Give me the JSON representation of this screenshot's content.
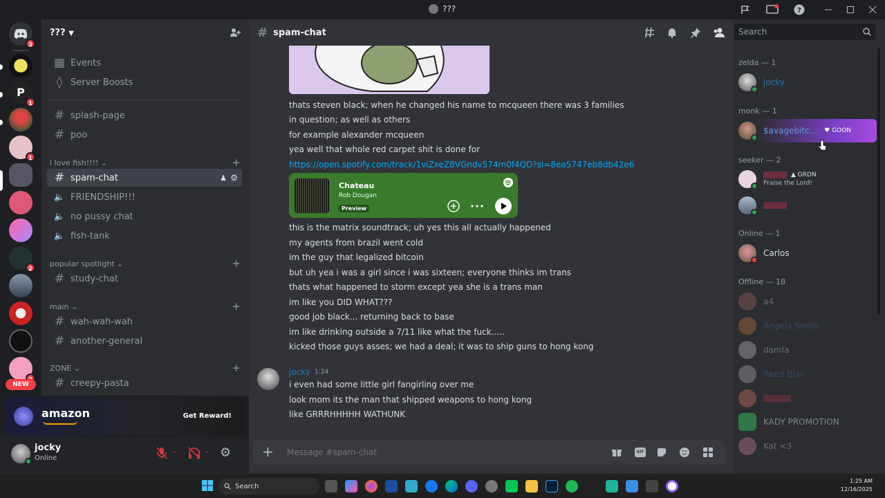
{
  "window": {
    "title": "???"
  },
  "server": {
    "name": "???"
  },
  "guild_badges": {
    "home": "3",
    "g3": "1",
    "g5": "1",
    "g9": "2",
    "g13": "2",
    "new": "NEW"
  },
  "sidebar": {
    "events": "Events",
    "boosts": "Server Boosts",
    "channels": [
      {
        "name": "splash-page",
        "type": "text"
      },
      {
        "name": "poo",
        "type": "text"
      }
    ],
    "cat1": "i love fish!!!!",
    "cat1_channels": [
      {
        "name": "spam-chat",
        "type": "text",
        "active": true
      },
      {
        "name": "FRIENDSHIP!!!",
        "type": "voice"
      },
      {
        "name": "no pussy chat",
        "type": "voice"
      },
      {
        "name": "fish-tank",
        "type": "voice"
      }
    ],
    "cat2": "popular spotlight",
    "cat2_channels": [
      {
        "name": "study-chat"
      }
    ],
    "cat3": "main",
    "cat3_channels": [
      {
        "name": "wah-wah-wah"
      },
      {
        "name": "another-general"
      }
    ],
    "cat4": "ZONE",
    "cat4_channels": [
      {
        "name": "creepy-pasta"
      }
    ]
  },
  "promo": {
    "brand": "amazon",
    "cta": "Get Reward!"
  },
  "user": {
    "name": "jocky",
    "status": "Online"
  },
  "channel": {
    "name": "spam-chat",
    "placeholder": "Message #spam-chat"
  },
  "messages": {
    "block1": [
      "thats steven black; when he changed his name to mcqueen there was 3 families",
      "in question; as well as others",
      "for example alexander mcqueen",
      "yea well that whole red carpet shit is done for"
    ],
    "link": "https://open.spotify.com/track/1viZxeZ8VGndv574m0f4QD?si=8ea5747eb8db42e6",
    "spotify": {
      "title": "Chateau",
      "artist": "Rob Dougan",
      "badge": "Preview"
    },
    "block2": [
      "this is the matrix soundtrack; uh yes this all actually happened",
      "my agents from brazil went cold",
      "im the guy that legalized bitcoin",
      "but uh yea i was a girl since i was sixteen; everyone thinks im trans",
      "thats what happened to storm except yea she is a trans man",
      "im like you DID WHAT???",
      "good job black... returning back to base",
      "im like drinking outside a 7/11 like what the fuck.....",
      "kicked those guys asses; we had a deal; it was to ship guns to hong kong"
    ],
    "author2": "jocky",
    "time2": "1:24",
    "block3": [
      "i even had some little girl fangirling over me",
      "look mom its the man that shipped weapons to hong kong",
      "like GRRRHHHHH WATHUNK"
    ]
  },
  "search": {
    "placeholder": "Search"
  },
  "members": {
    "zelda": "zelda — 1",
    "zelda_m": "jocky",
    "monk": "monk — 1",
    "monk_m": "$avagebitc...",
    "monk_tag": "GOON",
    "seeker": "seeker — 2",
    "seeker_tag": "GRDN",
    "seeker_sub": "Praise the Lord!",
    "online": "Online — 1",
    "online_m": "Carlos",
    "offline": "Offline — 18",
    "off": [
      "a4",
      "Angela Smith",
      "damla",
      "Reed Blair",
      "",
      "KADY PROMOTION",
      "Kat <3"
    ]
  },
  "taskbar": {
    "search": "Search",
    "time": "1:25 AM",
    "date": "12/16/2025"
  },
  "colors": {
    "accent": "#5865f2",
    "online": "#23a55a",
    "spotify": "#3a7a2c",
    "link": "#00a8fc"
  }
}
